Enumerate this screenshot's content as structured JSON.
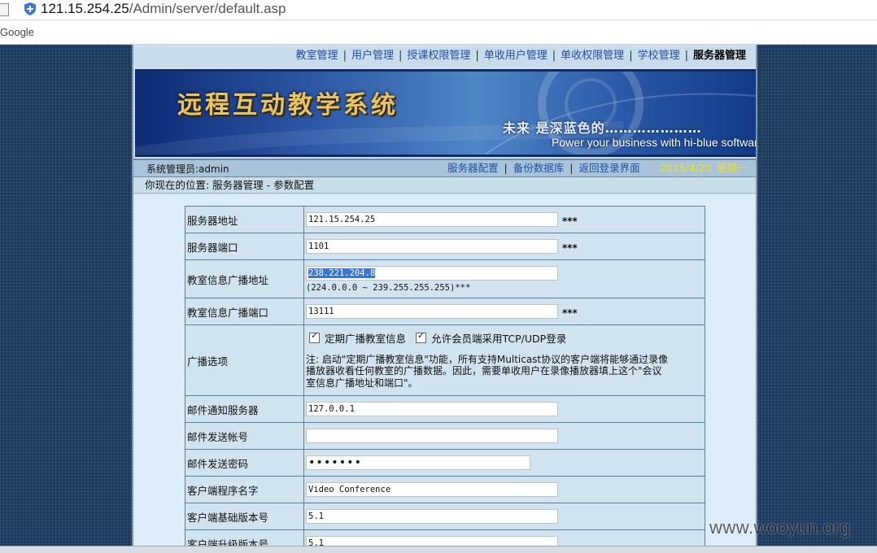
{
  "browser": {
    "url_host": "121.15.254.25",
    "url_path": "/Admin/server/default.asp",
    "bookmark": "Google"
  },
  "nav": {
    "items": [
      "教室管理",
      "用户管理",
      "授课权限管理",
      "单收用户管理",
      "单收权限管理",
      "学校管理"
    ],
    "active": "服务器管理"
  },
  "banner": {
    "title": "远程互动教学系统",
    "slogan": "未来 是深蓝色的…………………",
    "tagline": "Power your business with hi-blue software"
  },
  "info": {
    "admin_label": "系统管理员:admin",
    "links": [
      "服务器配置",
      "备份数据库",
      "返回登录界面"
    ],
    "date": "2015/4/20",
    "weekday": "星期一"
  },
  "location": "你现在的位置: 服务器管理 - 参数配置",
  "form": {
    "server_address": {
      "label": "服务器地址",
      "value": "121.15.254.25",
      "required": "***"
    },
    "server_port": {
      "label": "服务器端口",
      "value": "1101",
      "required": "***"
    },
    "broadcast_address": {
      "label": "教室信息广播地址",
      "value": "238.221.204.8",
      "hint": "(224.0.0.0 ~ 239.255.255.255)***"
    },
    "broadcast_port": {
      "label": "教室信息广播端口",
      "value": "13111",
      "required": "***"
    },
    "broadcast_options": {
      "label": "广播选项",
      "opt1": "定期广播教室信息",
      "opt2": "允许会员端采用TCP/UDP登录",
      "note": "注: 启动\"定期广播教室信息\"功能，所有支持Multicast协议的客户端将能够通过录像播放器收看任何教室的广播数据。因此，需要单收用户在录像播放器填上这个\"会议室信息广播地址和端口\"。"
    },
    "mail_server": {
      "label": "邮件通知服务器",
      "value": "127.0.0.1"
    },
    "mail_account": {
      "label": "邮件发送帐号",
      "value": ""
    },
    "mail_password": {
      "label": "邮件发送密码",
      "value": "•••••••"
    },
    "client_name": {
      "label": "客户端程序名字",
      "value": "Video Conference"
    },
    "client_base_version": {
      "label": "客户端基础版本号",
      "value": "5.1"
    },
    "client_upgrade_version": {
      "label": "客户端升级版本号",
      "value": "5.1"
    }
  },
  "watermark": "www.wooyun.org"
}
